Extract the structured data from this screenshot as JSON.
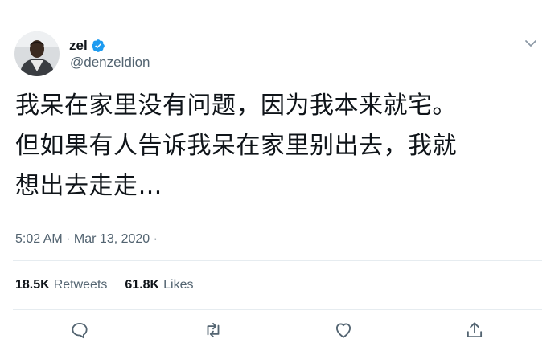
{
  "author": {
    "display_name": "zel",
    "handle": "@denzeldion",
    "verified": true
  },
  "tweet": {
    "lines": [
      "我呆在家里没有问题，因为我本来就宅。",
      "但如果有人告诉我呆在家里别出去，我就",
      "想出去走走…"
    ],
    "timestamp": "5:02 AM · Mar 13, 2020 ·"
  },
  "stats": {
    "retweets_count": "18.5K",
    "retweets_label": "Retweets",
    "likes_count": "61.8K",
    "likes_label": "Likes"
  },
  "icons": {
    "verified": "verified-badge-icon",
    "caret": "chevron-down-icon",
    "reply": "reply-icon",
    "retweet": "retweet-icon",
    "like": "heart-icon",
    "share": "share-icon"
  },
  "colors": {
    "text": "#0f1419",
    "secondary": "#536471",
    "verified": "#1d9bf0",
    "divider": "#e6ecf0"
  }
}
